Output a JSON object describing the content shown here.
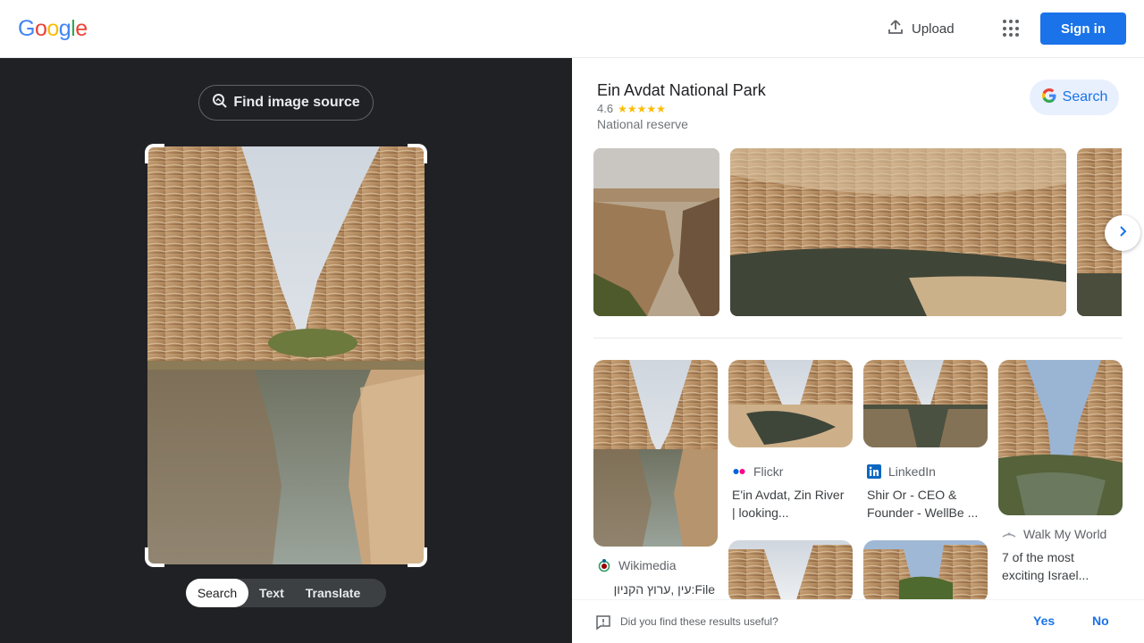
{
  "header": {
    "logo_letters": [
      "G",
      "o",
      "o",
      "g",
      "l",
      "e"
    ],
    "logo_colors": [
      "#4285f4",
      "#ea4335",
      "#fbbc05",
      "#4285f4",
      "#34a853",
      "#ea4335"
    ],
    "upload_label": "Upload",
    "apps_icon": "apps-grid-icon",
    "signin_label": "Sign in"
  },
  "lens": {
    "find_source_label": "Find image source",
    "modes": [
      "Search",
      "Text",
      "Translate"
    ],
    "active_mode": "Search"
  },
  "knowledge_panel": {
    "title": "Ein Avdat National Park",
    "rating": "4.6",
    "stars": "★★★★★",
    "type": "National reserve",
    "search_label": "Search"
  },
  "results": [
    {
      "source": "Wikimedia",
      "title": "File:עין ,ערוץ הקניון"
    },
    {
      "source": "Flickr",
      "title": "E'in Avdat, Zin River | looking..."
    },
    {
      "source": "LinkedIn",
      "title": "Shir Or - CEO & Founder - WellBe ..."
    },
    {
      "source": "Walk My World",
      "title": "7 of the most exciting Israel..."
    }
  ],
  "feedback": {
    "question": "Did you find these results useful?",
    "yes_label": "Yes",
    "no_label": "No"
  },
  "colors": {
    "accent": "#1a73e8",
    "dark_bg": "#202124",
    "star": "#fbbc04"
  }
}
